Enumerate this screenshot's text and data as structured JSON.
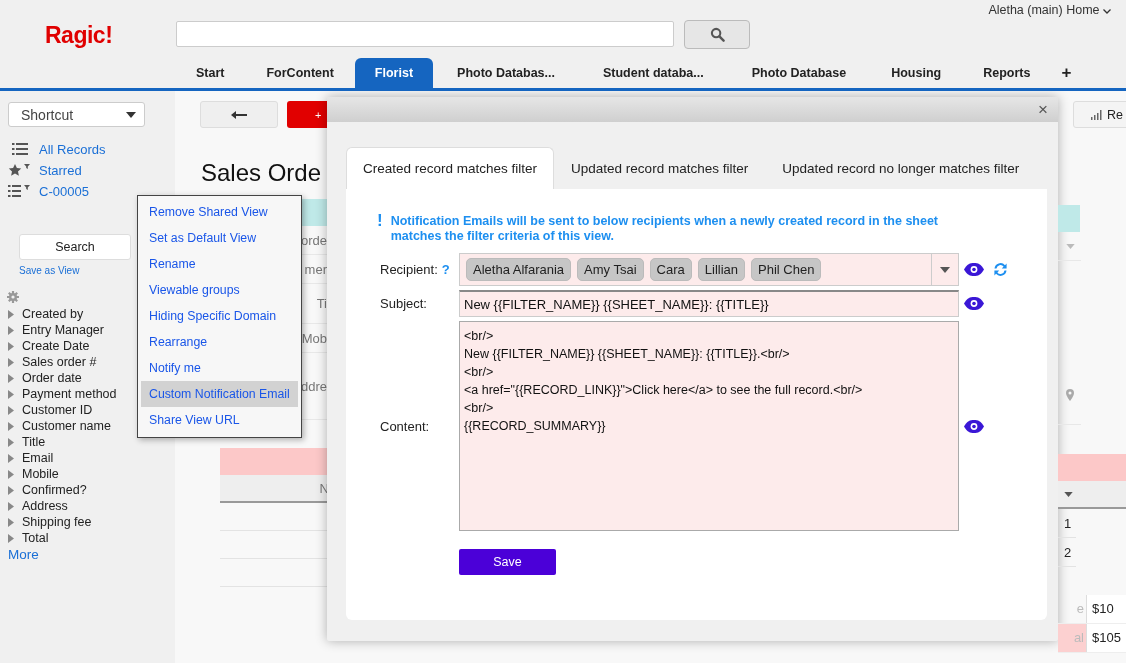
{
  "header": {
    "logo": "Ragic!",
    "user_menu": "Aletha (main) Home",
    "add_tab": "+"
  },
  "nav_tabs": [
    {
      "label": "Start",
      "selected": false
    },
    {
      "label": "ForContent",
      "selected": false
    },
    {
      "label": "Florist",
      "selected": true
    },
    {
      "label": "Photo Databas...",
      "selected": false
    },
    {
      "label": "Student databa...",
      "selected": false
    },
    {
      "label": "Photo Database",
      "selected": false
    },
    {
      "label": "Housing",
      "selected": false
    },
    {
      "label": "Reports",
      "selected": false
    }
  ],
  "sidebar": {
    "shortcut": "Shortcut",
    "views": [
      {
        "label": "All Records",
        "kind": "list"
      },
      {
        "label": "Starred",
        "kind": "star"
      },
      {
        "label": "C-00005",
        "kind": "filter"
      }
    ],
    "search_button": "Search",
    "save_as_view": "Save as View",
    "fields": [
      "Created by",
      "Entry Manager",
      "Create Date",
      "Sales order #",
      "Order date",
      "Payment method",
      "Customer ID",
      "Customer name",
      "Title",
      "Email",
      "Mobile",
      "Confirmed?",
      "Address",
      "Shipping fee",
      "Total"
    ],
    "more": "More"
  },
  "context_menu": [
    {
      "label": "Remove Shared View",
      "selected": false
    },
    {
      "label": "Set as Default View",
      "selected": false
    },
    {
      "label": "Rename",
      "selected": false
    },
    {
      "label": "Viewable groups",
      "selected": false
    },
    {
      "label": "Hiding Specific Domain",
      "selected": false
    },
    {
      "label": "Rearrange",
      "selected": false
    },
    {
      "label": "Notify me",
      "selected": false
    },
    {
      "label": "Custom Notification Email",
      "selected": true
    },
    {
      "label": "Share View URL",
      "selected": false
    }
  ],
  "background": {
    "new_button": "+",
    "title": "Sales Orde",
    "form_labels": [
      "orde",
      "mer",
      "Ti",
      "Mob",
      "ddre"
    ],
    "column_header": "N",
    "right_button": "Re",
    "row_numbers": [
      "1",
      "2"
    ],
    "summary": [
      {
        "label": "e",
        "value": "$10",
        "highlighted": false
      },
      {
        "label": "al",
        "value": "$105",
        "highlighted": true
      }
    ]
  },
  "dialog": {
    "close": "×",
    "tabs": [
      {
        "label": "Created record matches filter",
        "selected": true
      },
      {
        "label": "Updated record matches filter",
        "selected": false
      },
      {
        "label": "Updated record no longer matches filter",
        "selected": false
      }
    ],
    "notice_mark": "!",
    "notice": "Notification Emails will be sent to below recipients when a newly created record in the sheet matches the filter criteria of this view.",
    "recipient_label": "Recipient:",
    "help": "?",
    "recipients": [
      "Aletha Alfarania",
      "Amy Tsai",
      "Cara",
      "Lillian",
      "Phil Chen"
    ],
    "subject_label": "Subject:",
    "subject": "New {{FILTER_NAME}} {{SHEET_NAME}}: {{TITLE}}",
    "content_label": "Content:",
    "content": "<br/>\nNew {{FILTER_NAME}} {{SHEET_NAME}}: {{TITLE}}.<br/>\n<br/>\n<a href=\"{{RECORD_LINK}}\">Click here</a> to see the full record.<br/>\n<br/>\n{{RECORD_SUMMARY}}",
    "save": "Save"
  }
}
